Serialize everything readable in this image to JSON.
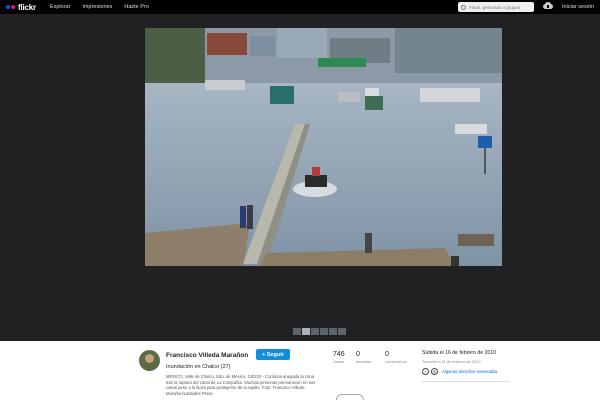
{
  "nav": {
    "brand": "flickr",
    "items": [
      "Explorar",
      "Impresiones",
      "Hazte Pro"
    ],
    "search_placeholder": "Fotos, personas o grupos",
    "signin": "Iniciar sesión"
  },
  "photo": {
    "thumbnail_count": 6,
    "active_thumbnail": 1
  },
  "owner": {
    "name": "Francisco Villeda Marañon",
    "follow_label": "+ Seguir"
  },
  "photo_info": {
    "title": "Inundación en Chalco (27)",
    "description": "MÉXICO, Valle de Chalco, Edo. de México, 130210 - Continúa anegada la zona tras la ruptura del canal de La Compañía. Muchas personas permanecen en sus casas pese a la lluvia para protegerse de la rapiña. Foto: Francisco Villeda Marañon/Latitudes Press"
  },
  "stats": [
    {
      "num": "746",
      "label": "Vistas"
    },
    {
      "num": "0",
      "label": "favoritos"
    },
    {
      "num": "0",
      "label": "comentarios"
    }
  ],
  "dates": {
    "uploaded": "Subida el 16 de febrero de 2010",
    "taken": "Tomada el 11 de febrero de 2010"
  },
  "license": {
    "icons": [
      "i",
      "$"
    ],
    "text": "Algunos derechos reservados"
  },
  "colors": {
    "topbar": "#000000",
    "stage": "#212124",
    "accent": "#128fdc",
    "brand_blue": "#0063dc",
    "brand_pink": "#ff0084"
  }
}
